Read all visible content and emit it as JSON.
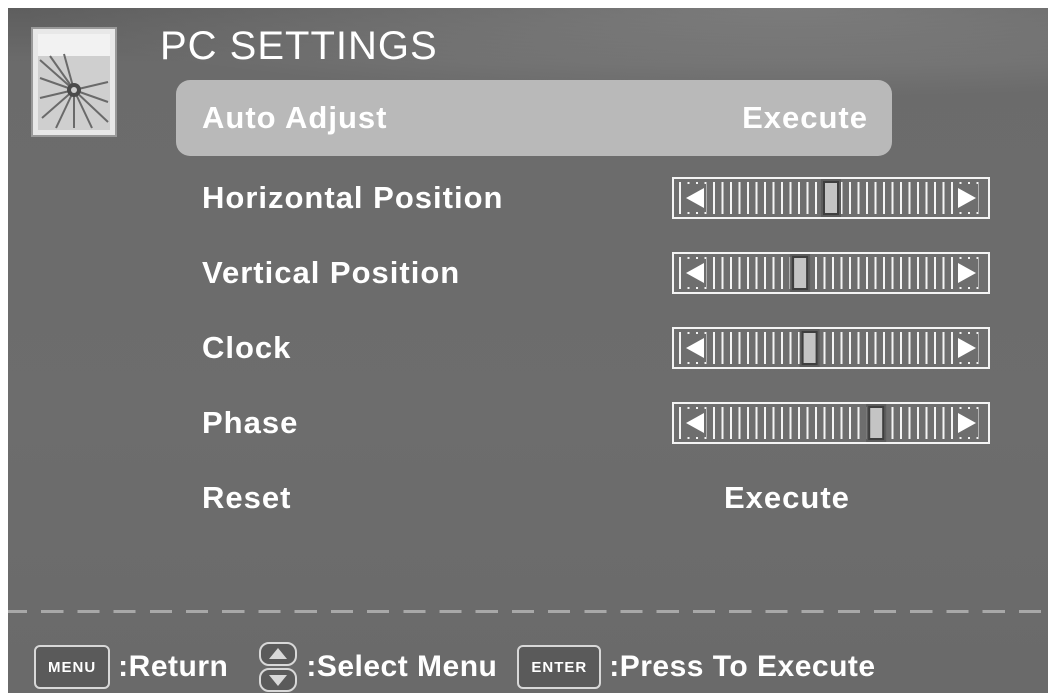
{
  "title": "PC SETTINGS",
  "colors": {
    "panel_bg": "#6a6a6a",
    "selected_row_bg": "#b9b9b9",
    "text": "#ffffff",
    "divider": "#a8a8a8"
  },
  "menu_icon": "pc-settings-picture-icon",
  "items": [
    {
      "label": "Auto Adjust",
      "type": "action",
      "value": "Execute",
      "selected": true
    },
    {
      "label": "Horizontal Position",
      "type": "slider",
      "level": 0.5
    },
    {
      "label": "Vertical Position",
      "type": "slider",
      "level": 0.37
    },
    {
      "label": "Clock",
      "type": "slider",
      "level": 0.41
    },
    {
      "label": "Phase",
      "type": "slider",
      "level": 0.69
    },
    {
      "label": "Reset",
      "type": "action",
      "value": "Execute",
      "selected": false
    }
  ],
  "footer": {
    "menu_key": "MENU",
    "menu_hint": ":Return",
    "nav_icon": "up-down-arrows-icon",
    "nav_hint": ":Select Menu",
    "enter_key": "ENTER",
    "enter_hint": ":Press To Execute"
  }
}
